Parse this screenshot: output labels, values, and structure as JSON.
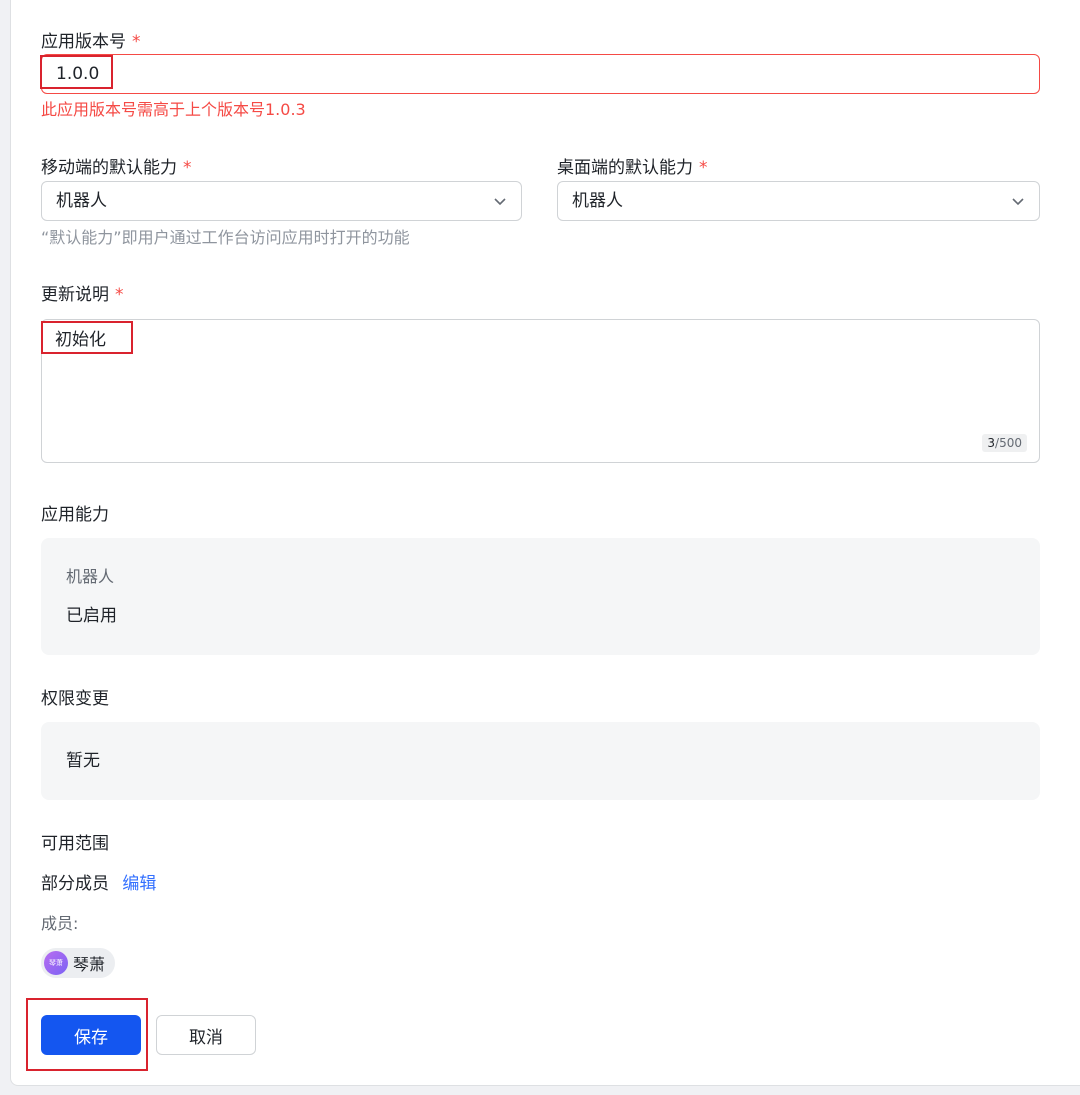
{
  "form": {
    "version": {
      "label": "应用版本号",
      "required_mark": "*",
      "value": "1.0.0",
      "error": "此应用版本号需高于上个版本号1.0.3"
    },
    "mobile_default": {
      "label": "移动端的默认能力",
      "required_mark": "*",
      "value": "机器人"
    },
    "desktop_default": {
      "label": "桌面端的默认能力",
      "required_mark": "*",
      "value": "机器人"
    },
    "default_hint": "“默认能力”即用户通过工作台访问应用时打开的功能",
    "release_notes": {
      "label": "更新说明",
      "required_mark": "*",
      "value": "初始化",
      "count_current": "3",
      "count_max": "/500"
    },
    "capabilities": {
      "label": "应用能力",
      "item_name": "机器人",
      "item_status": "已启用"
    },
    "permissions": {
      "label": "权限变更",
      "value": "暂无"
    },
    "scope": {
      "label": "可用范围",
      "value": "部分成员",
      "edit_link": "编辑",
      "members_label": "成员:",
      "members": [
        {
          "name": "琴萧",
          "avatar_text": "琴萧"
        }
      ]
    }
  },
  "actions": {
    "save_label": "保存",
    "cancel_label": "取消"
  },
  "colors": {
    "primary": "#1456f0",
    "error": "#f54a45",
    "link": "#3370ff",
    "annotation": "#d9232e"
  },
  "icons": {
    "select_chevron": "chevron-down-icon"
  }
}
